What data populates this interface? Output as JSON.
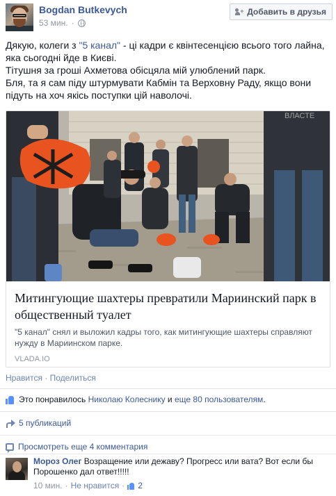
{
  "post": {
    "author": "Bogdan Butkevych",
    "time": "53 мин.",
    "privacy_icon": "globe-icon",
    "add_friend_label": "Добавить в друзья",
    "text": {
      "line1_prefix": "Дякую, колеги з ",
      "line1_link": "\"5 канал\"",
      "line1_suffix": " - ці кадри є квінтесенцією всього того лайна, яка сьогодні йде в Києві.",
      "line2": "Тітушня за гроші Ахметова обісцяла мій улюблений парк.",
      "line3": "Бля, та я сам піду штурмувати Кабмін та Верховну Раду, якщо вони підуть на хоч якісь поступки цій наволочі."
    }
  },
  "link_card": {
    "image_description_icon": "photo-miners-in-park",
    "watermark": "ВЛАСТЕ",
    "title": "Митингующие шахтеры превратили Мариинский парк в общественный туалет",
    "description": "\"5 канал\" снял и выложил кадры того, как митингующие шахтеры справляют нужду в Мариинском парке.",
    "domain": "VLADA.IO"
  },
  "actions": {
    "like": "Нравится",
    "separator": "·",
    "share": "Поделиться"
  },
  "likes": {
    "prefix": "Это понравилось ",
    "user": "Николаю Колеснику",
    "middle": " и ",
    "others": "еще 80 пользователям",
    "suffix": "."
  },
  "shares": {
    "label": "5 публикаций"
  },
  "comments": {
    "more_label": "Просмотреть еще 4 комментария",
    "items": [
      {
        "author": "Мороз Олег",
        "text": "Возращение или дежаву? Прогресс или вата? Вот если бы Порошенко дал ответ!!!!!",
        "time": "10 мин.",
        "separator": "·",
        "unlike": "Не нравится",
        "like_count": "2"
      }
    ]
  },
  "colors": {
    "link": "#3b5998",
    "meta": "#9197a3",
    "like_blue": "#5890ff",
    "helmet_orange": "#e8531f"
  }
}
